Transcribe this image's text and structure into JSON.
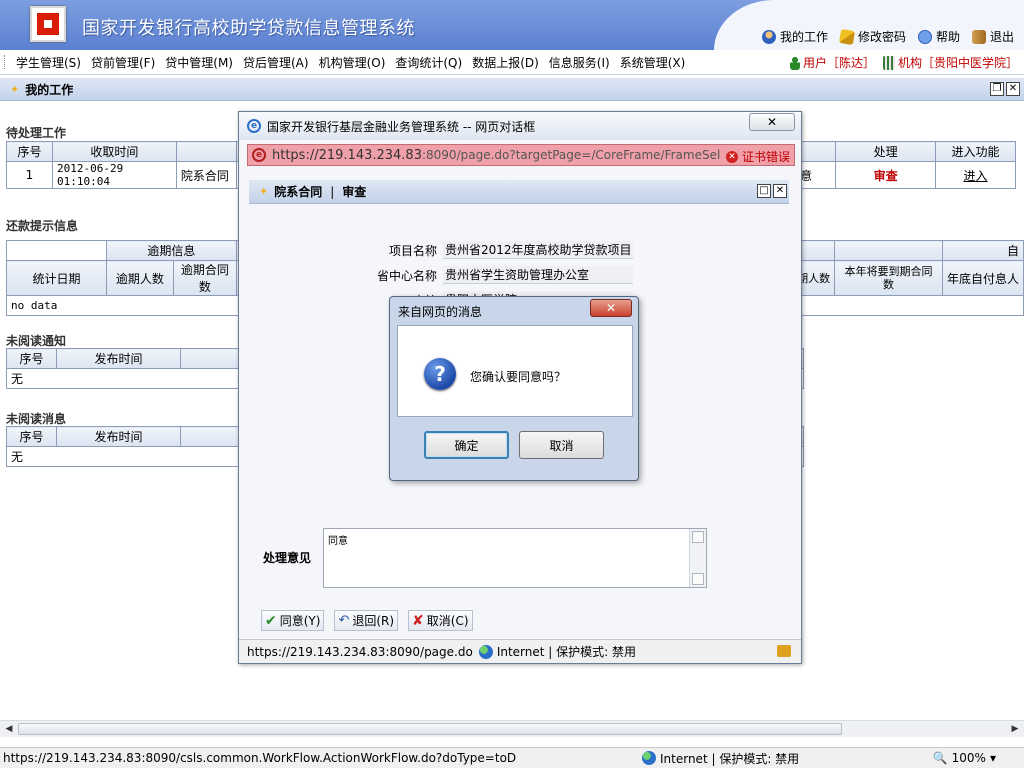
{
  "app": {
    "title": "国家开发银行高校助学贷款信息管理系统",
    "links": [
      "我的工作",
      "修改密码",
      "帮助",
      "退出"
    ]
  },
  "menu": {
    "items": [
      "学生管理(S)",
      "贷前管理(F)",
      "贷中管理(M)",
      "贷后管理(A)",
      "机构管理(O)",
      "查询统计(Q)",
      "数据上报(D)",
      "信息服务(I)",
      "系统管理(X)"
    ],
    "user": "用户［陈达］",
    "org": "机构［贵阳中医学院］"
  },
  "mywork": {
    "title": "我的工作"
  },
  "pending": {
    "title": "待处理工作",
    "headers": {
      "no": "序号",
      "time": "收取时间",
      "c3": "",
      "c4": "",
      "status": "",
      "handle": "处理",
      "enter": "进入功能"
    },
    "row": {
      "no": "1",
      "time": "2012-06-29 01:10:04",
      "c3": "院系合同",
      "status": "意",
      "handle": "审查",
      "enter": "进入"
    }
  },
  "repay": {
    "title": "还款提示信息",
    "group1": "逾期信息",
    "group2": "自",
    "headers": [
      "统计日期",
      "逾期人数",
      "逾期合同数",
      "期人数",
      "本年将要到期合同数",
      "年底自付息人"
    ],
    "nodata": "no data"
  },
  "notices": {
    "title": "未阅读通知",
    "headers": [
      "序号",
      "发布时间"
    ],
    "empty": "无"
  },
  "messages": {
    "title": "未阅读消息",
    "headers": [
      "序号",
      "发布时间"
    ],
    "empty": "无"
  },
  "statusbar": {
    "url": "https://219.143.234.83:8090/csls.common.WorkFlow.ActionWorkFlow.do?doType=toD",
    "zone": "Internet | 保护模式: 禁用",
    "zoom": "100%"
  },
  "dialog": {
    "title": "国家开发银行基层金融业务管理系统 -- 网页对话框",
    "close": "✕",
    "address_host": "https://219.143.234.83",
    "address_rest": ":8090/page.do?targetPage=/CoreFrame/FrameSelect.",
    "cert": "证书错误",
    "section": "院系合同",
    "section_sub": "审查",
    "fields": [
      {
        "label": "项目名称",
        "value": "贵州省2012年度高校助学贷款项目"
      },
      {
        "label": "省中心名称",
        "value": "贵州省学生资助管理办公室"
      },
      {
        "label": "高校",
        "value": "贵阳中医学院"
      }
    ],
    "opinion_label": "处理意见",
    "opinion_value": "同意",
    "buttons": [
      "同意(Y)",
      "退回(R)",
      "取消(C)"
    ],
    "status_url": "https://219.143.234.83:8090/page.do",
    "status_zone": "Internet | 保护模式: 禁用"
  },
  "msgbox": {
    "title": "来自网页的消息",
    "text": "您确认要同意吗？",
    "ok": "确定",
    "cancel": "取消"
  }
}
